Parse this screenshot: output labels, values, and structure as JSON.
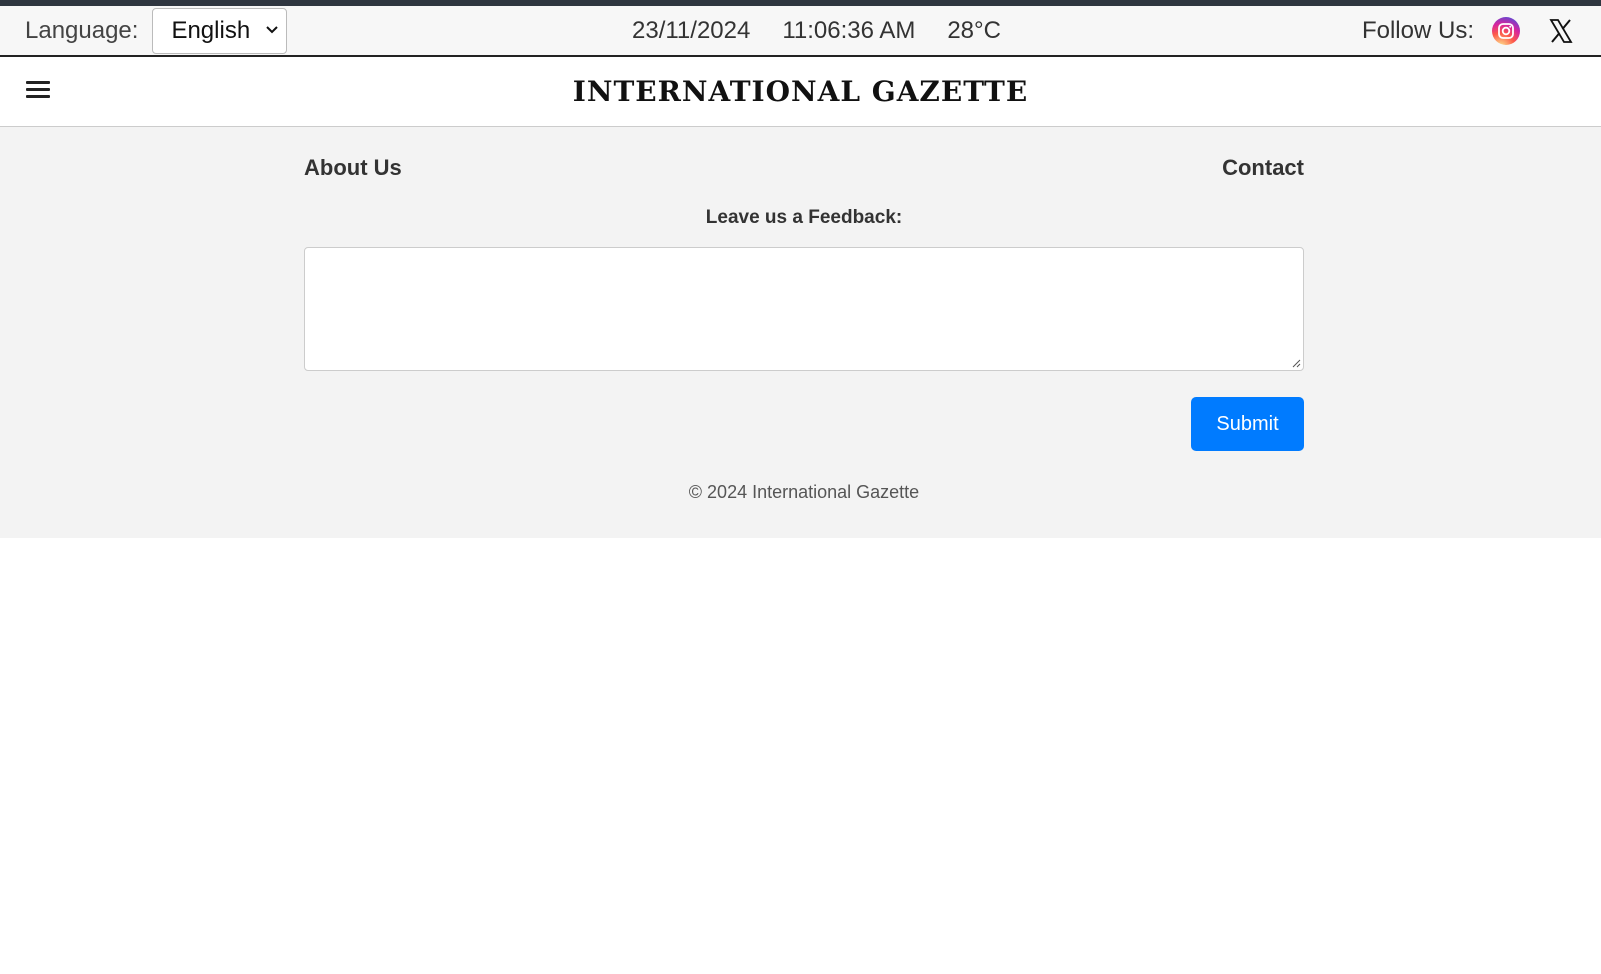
{
  "topbar": {
    "language_label": "Language:",
    "language_selected": "English",
    "date": "23/11/2024",
    "time": "11:06:36 AM",
    "temperature": "28°C",
    "follow_label": "Follow Us:",
    "social_icons": [
      "instagram-icon",
      "x-icon"
    ]
  },
  "header": {
    "menu_icon": "hamburger-icon",
    "title": "INTERNATIONAL GAZETTE"
  },
  "footer": {
    "about_link": "About Us",
    "contact_link": "Contact",
    "feedback_label": "Leave us a Feedback:",
    "feedback_value": "",
    "submit_label": "Submit",
    "copyright": "© 2024 International Gazette"
  },
  "colors": {
    "accent_bar": "#2f3640",
    "submit_button": "#007bff",
    "footer_bg": "#f3f3f3"
  }
}
